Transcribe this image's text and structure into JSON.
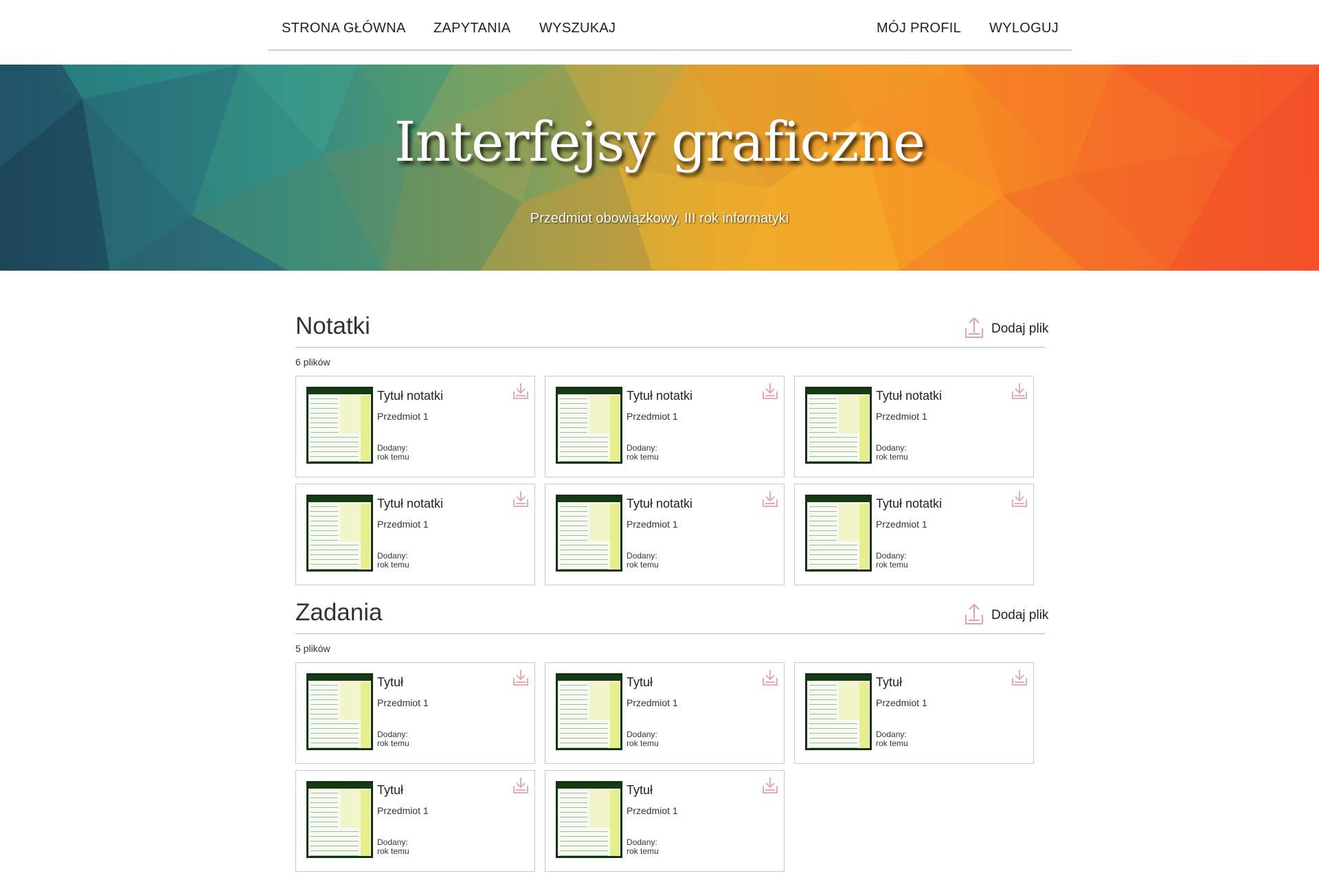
{
  "nav": {
    "items": [
      "STRONA GŁÓWNA",
      "ZAPYTANIA",
      "WYSZUKAJ"
    ],
    "profile": "MÓJ PROFIL",
    "logout": "WYLOGUJ"
  },
  "hero": {
    "title": "Interfejsy graficzne",
    "subtitle": "Przedmiot obowiązkowy, III rok informatyki"
  },
  "colors": {
    "accent_icon": "#e8a0a8",
    "hero_left": "#1f4f63",
    "hero_mid": "#f2a62a",
    "hero_right": "#f5532a"
  },
  "sections": [
    {
      "title": "Notatki",
      "add_label": "Dodaj plik",
      "count": "6 plików",
      "items": [
        {
          "title": "Tytuł notatki",
          "subject": "Przedmiot 1",
          "added_label": "Dodany:",
          "added_value": "rok temu"
        },
        {
          "title": "Tytuł notatki",
          "subject": "Przedmiot 1",
          "added_label": "Dodany:",
          "added_value": "rok temu"
        },
        {
          "title": "Tytuł notatki",
          "subject": "Przedmiot 1",
          "added_label": "Dodany:",
          "added_value": "rok temu"
        },
        {
          "title": "Tytuł notatki",
          "subject": "Przedmiot 1",
          "added_label": "Dodany:",
          "added_value": "rok temu"
        },
        {
          "title": "Tytuł notatki",
          "subject": "Przedmiot 1",
          "added_label": "Dodany:",
          "added_value": "rok temu"
        },
        {
          "title": "Tytuł notatki",
          "subject": "Przedmiot 1",
          "added_label": "Dodany:",
          "added_value": "rok temu"
        }
      ]
    },
    {
      "title": "Zadania",
      "add_label": "Dodaj plik",
      "count": "5 plików",
      "items": [
        {
          "title": "Tytuł",
          "subject": "Przedmiot 1",
          "added_label": "Dodany:",
          "added_value": "rok temu"
        },
        {
          "title": "Tytuł",
          "subject": "Przedmiot 1",
          "added_label": "Dodany:",
          "added_value": "rok temu"
        },
        {
          "title": "Tytuł",
          "subject": "Przedmiot 1",
          "added_label": "Dodany:",
          "added_value": "rok temu"
        },
        {
          "title": "Tytuł",
          "subject": "Przedmiot 1",
          "added_label": "Dodany:",
          "added_value": "rok temu"
        },
        {
          "title": "Tytuł",
          "subject": "Przedmiot 1",
          "added_label": "Dodany:",
          "added_value": "rok temu"
        }
      ]
    }
  ]
}
